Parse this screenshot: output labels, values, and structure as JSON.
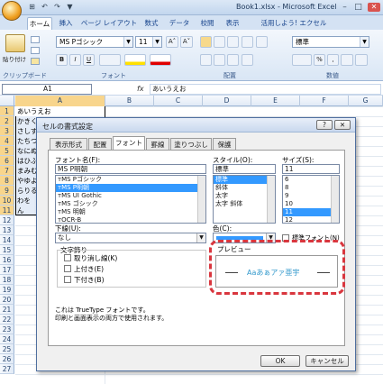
{
  "window": {
    "title": "Book1.xlsx - Microsoft Excel",
    "qat": [
      "⊞",
      "↶",
      "↷",
      "▼"
    ],
    "controls": [
      "–",
      "□",
      "✕"
    ]
  },
  "ribbon": {
    "tabs": [
      "ホーム",
      "挿入",
      "ページ レイアウト",
      "数式",
      "データ",
      "校閲",
      "表示",
      "活用しよう! エクセル"
    ],
    "paste_label": "貼り付け",
    "font_name": "MS Pゴシック",
    "font_size": "11",
    "number_format": "標準",
    "buttons": {
      "bold": "B",
      "italic": "I",
      "underline": "U",
      "percent": "%",
      "comma": ",",
      "increase": "A˄",
      "decrease": "A˅"
    },
    "groups": {
      "clipboard": "クリップボード",
      "font": "フォント",
      "alignment": "配置",
      "number": "数値"
    }
  },
  "formula_bar": {
    "cell_ref": "A1",
    "fx": "fx",
    "value": "あいうえお"
  },
  "sheet": {
    "columns": [
      "A",
      "B",
      "C",
      "D",
      "E",
      "F",
      "G"
    ],
    "rows": [
      "1",
      "2",
      "3",
      "4",
      "5",
      "6",
      "7",
      "8",
      "9",
      "10",
      "11",
      "12",
      "13",
      "14",
      "15",
      "16",
      "17",
      "18",
      "19",
      "20",
      "21",
      "22",
      "23",
      "24",
      "25",
      "26",
      "27"
    ],
    "cells": [
      "あいうえお",
      "かきく",
      "さしす",
      "たちつ",
      "なにぬ",
      "はひふ",
      "まみむ",
      "やゆよ",
      "らりる",
      "わを",
      "ん"
    ]
  },
  "dialog": {
    "title": "セルの書式設定",
    "help": "?",
    "close": "✕",
    "tabs": [
      "表示形式",
      "配置",
      "フォント",
      "罫線",
      "塗りつぶし",
      "保護"
    ],
    "font_label": "フォント名(F):",
    "font_value": "MS P明朝",
    "font_list": [
      "ᴛMS Pゴシック",
      "ᴛMS P明朝",
      "ᴛMS UI Gothic",
      "ᴛMS ゴシック",
      "ᴛMS 明朝",
      "ᴛOCR-B"
    ],
    "style_label": "スタイル(O):",
    "style_value": "標準",
    "style_list": [
      "標準",
      "斜体",
      "太字",
      "太字 斜体"
    ],
    "size_label": "サイズ(S):",
    "size_value": "11",
    "size_list": [
      "6",
      "8",
      "9",
      "10",
      "11",
      "12"
    ],
    "underline_label": "下線(U):",
    "underline_value": "なし",
    "color_label": "色(C):",
    "normal_font_label": "標準フォント(N)",
    "effects_label": "文字飾り",
    "effects": [
      "取り消し線(K)",
      "上付き(E)",
      "下付き(B)"
    ],
    "preview_label": "プレビュー",
    "preview_text": "Aaあぁアァ亜宇",
    "note_line1": "これは TrueType フォントです。",
    "note_line2": "印刷と画面表示の両方で使用されます。",
    "ok": "OK",
    "cancel": "キャンセル"
  },
  "colors": {
    "highlight_circle": "#d9363e",
    "preview_text": "#3399cc",
    "selection": "#3399ff"
  }
}
